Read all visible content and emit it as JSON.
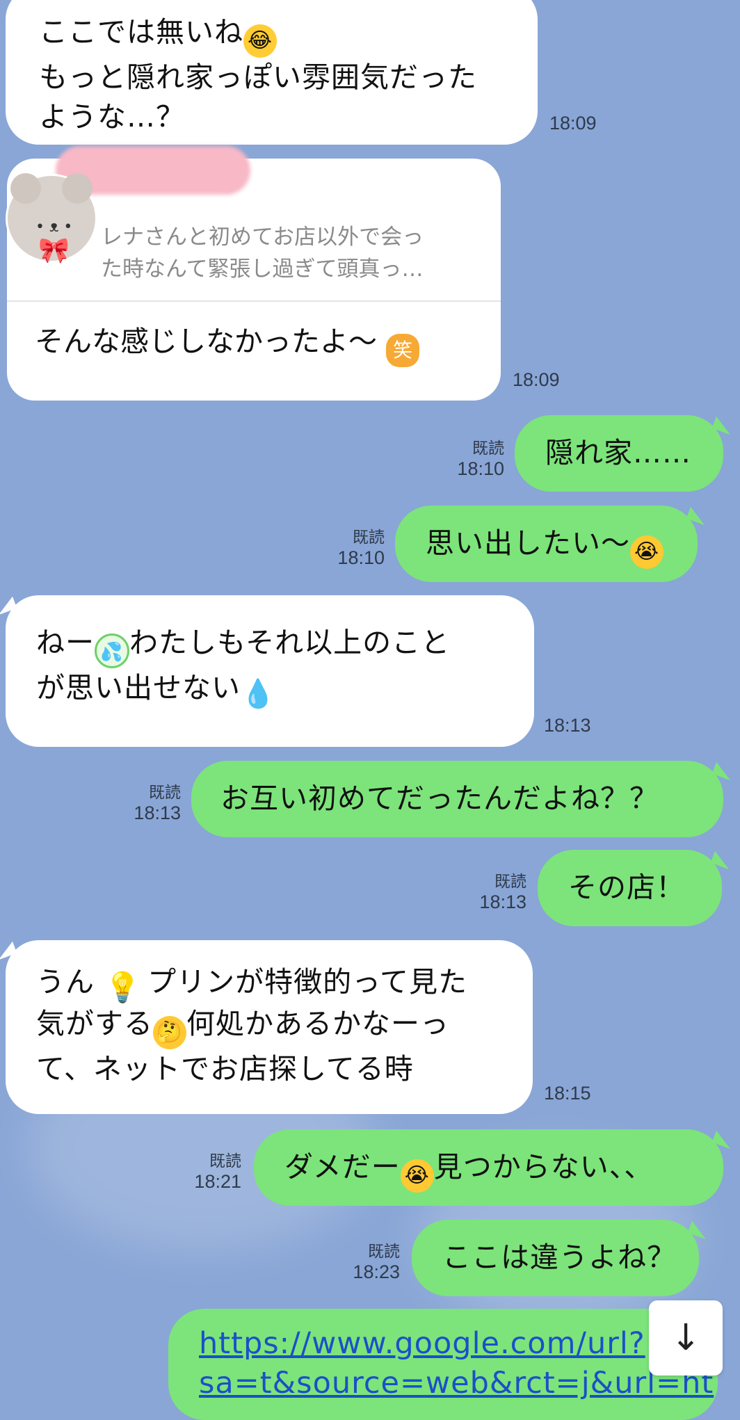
{
  "messages": {
    "m1": {
      "line1": "ここでは無いね",
      "line2": "もっと隠れ家っぽい雰囲気だった",
      "line3": "ような…？",
      "time": "18:09"
    },
    "m2": {
      "quote_line1": "レナさんと初めてお店以外で会っ",
      "quote_line2": "た時なんて緊張し過ぎて頭真っ…",
      "reply": "そんな感じしなかったよ〜",
      "time": "18:09"
    },
    "m3": {
      "text": "隠れ家……",
      "read": "既読",
      "time": "18:10"
    },
    "m4": {
      "text": "思い出したい〜",
      "read": "既読",
      "time": "18:10"
    },
    "m5": {
      "pre": "ねー",
      "post": "わたしもそれ以上のこと",
      "line2": "が思い出せない",
      "time": "18:13"
    },
    "m6": {
      "text": "お互い初めてだったんだよね？？",
      "read": "既読",
      "time": "18:13"
    },
    "m7": {
      "text": "その店！",
      "read": "既読",
      "time": "18:13"
    },
    "m8": {
      "line1_pre": "うん",
      "line1_post": "プリンが特徴的って見た",
      "line2_pre": "気がする",
      "line2_post": "何処かあるかなーっ",
      "line3": "て、ネットでお店探してる時",
      "time": "18:15"
    },
    "m9": {
      "pre": "ダメだー",
      "post": "見つからない、、",
      "read": "既読",
      "time": "18:21"
    },
    "m10": {
      "text": "ここは違うよね？",
      "read": "既読",
      "time": "18:23"
    },
    "m11": {
      "line1": "https://www.google.com/url?",
      "line2": "sa=t&source=web&rct=j&url=ht"
    }
  },
  "emoji_labels": {
    "warai": "笑"
  },
  "icons": {
    "laugh": "rolling-laughing-face",
    "cry": "loudly-crying-face",
    "sweat": "sweat-face",
    "drop": "sweat-droplets",
    "bulb": "light-bulb",
    "think": "thinking-face",
    "warai": "heart-warai",
    "scroll": "arrow-down"
  },
  "colors": {
    "background": "#89a6d6",
    "incoming": "#ffffff",
    "outgoing": "#7ce47a",
    "link": "#1b4fc9"
  }
}
